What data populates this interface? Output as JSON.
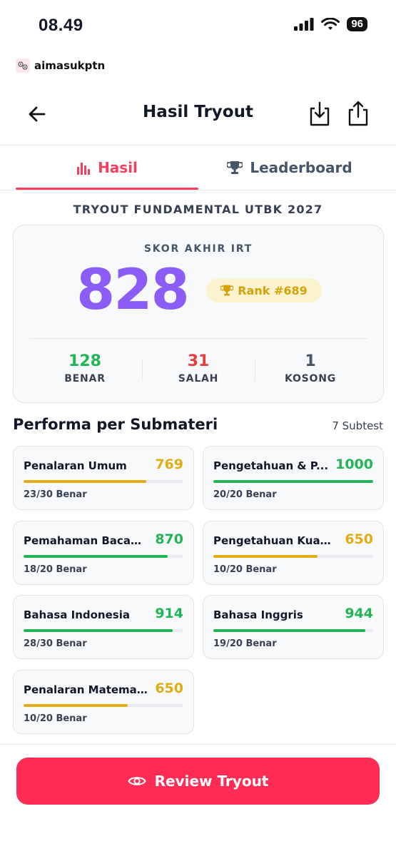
{
  "status_bar": {
    "time": "08.49",
    "battery": "96"
  },
  "brand": {
    "name": "aimasukptn"
  },
  "header": {
    "title": "Hasil Tryout"
  },
  "tabs": [
    {
      "label": "Hasil",
      "icon": "bar-chart-icon",
      "active": true
    },
    {
      "label": "Leaderboard",
      "icon": "trophy-icon",
      "active": false
    }
  ],
  "tryout_name": "TRYOUT FUNDAMENTAL UTBK 2027",
  "score": {
    "label": "SKOR AKHIR IRT",
    "value": "828",
    "rank": "Rank #689",
    "stats": [
      {
        "value": "128",
        "label": "BENAR",
        "color": "#22b455"
      },
      {
        "value": "31",
        "label": "SALAH",
        "color": "#e53e3e"
      },
      {
        "value": "1",
        "label": "KOSONG",
        "color": "#475569"
      }
    ]
  },
  "section": {
    "title": "Performa per Submateri",
    "count": "7 Subtest"
  },
  "subtests": [
    {
      "name": "Penalaran Umum",
      "score": "769",
      "correct_text": "23/30 Benar",
      "progress": 0.767,
      "color": "#e0ad12"
    },
    {
      "name": "Pengetahuan & P...",
      "score": "1000",
      "correct_text": "20/20 Benar",
      "progress": 1.0,
      "color": "#22b455"
    },
    {
      "name": "Pemahaman Bacaa...",
      "score": "870",
      "correct_text": "18/20 Benar",
      "progress": 0.9,
      "color": "#22b455"
    },
    {
      "name": "Pengetahuan Kuan...",
      "score": "650",
      "correct_text": "10/20 Benar",
      "progress": 0.65,
      "color": "#e0ad12"
    },
    {
      "name": "Bahasa Indonesia",
      "score": "914",
      "correct_text": "28/30 Benar",
      "progress": 0.933,
      "color": "#22b455"
    },
    {
      "name": "Bahasa Inggris",
      "score": "944",
      "correct_text": "19/20 Benar",
      "progress": 0.95,
      "color": "#22b455"
    },
    {
      "name": "Penalaran Matema...",
      "score": "650",
      "correct_text": "10/20 Benar",
      "progress": 0.65,
      "color": "#e0ad12"
    }
  ],
  "review_button": {
    "label": "Review Tryout"
  },
  "colors": {
    "accent": "#f43f5e",
    "score": "#8b5cf6",
    "button": "#ff2d55"
  }
}
